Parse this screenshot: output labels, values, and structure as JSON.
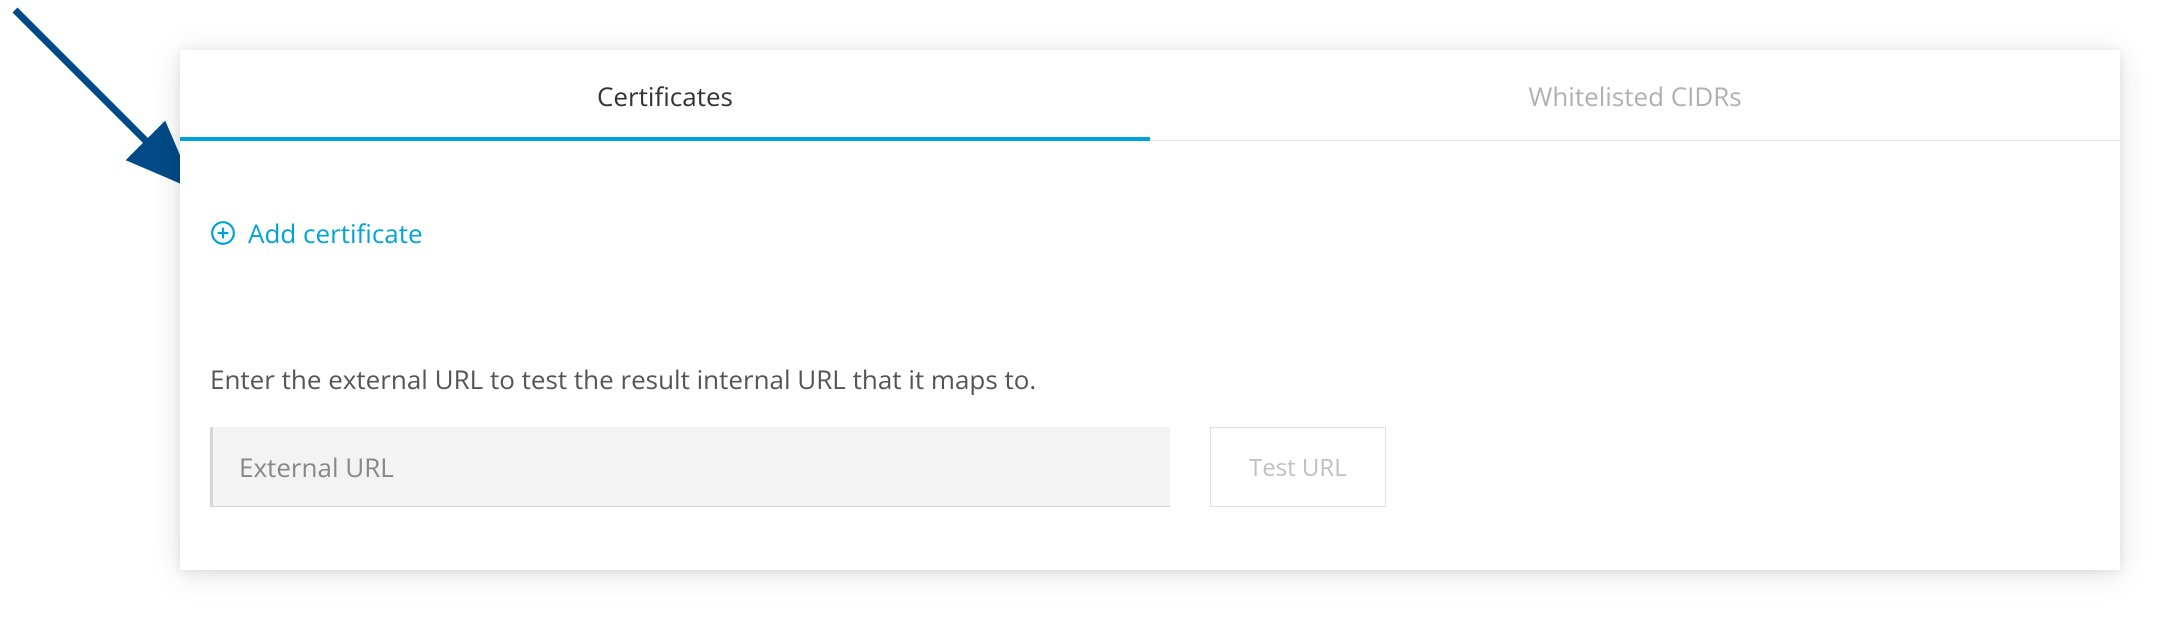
{
  "colors": {
    "accent": "#00a3d9",
    "arrow": "#004b87"
  },
  "tabs": [
    {
      "label": "Certificates",
      "active": true
    },
    {
      "label": "Whitelisted CIDRs",
      "active": false
    }
  ],
  "addCertificate": {
    "label": "Add certificate"
  },
  "testSection": {
    "description": "Enter the external URL to test the result internal URL that it maps to.",
    "placeholder": "External URL",
    "value": "",
    "buttonLabel": "Test URL"
  }
}
